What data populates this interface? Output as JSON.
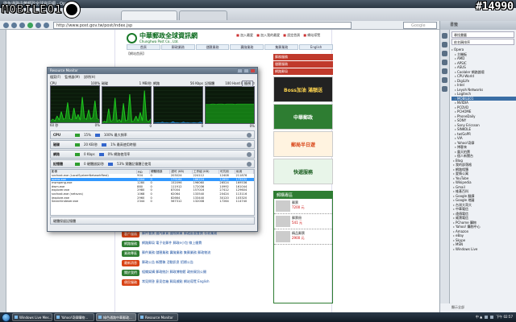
{
  "watermark": {
    "site": "MOBILE01",
    "post_id": "#14990"
  },
  "browser": {
    "title": "綠色通路中華郵政全球資訊網 - Opera",
    "address": "http://www.post.gov.tw/post/index.jsp",
    "search_placeholder": "Google"
  },
  "site": {
    "name_cn": "中華郵政全球資訊網",
    "name_en": "Chunghwa Post Co., Ltd.",
    "top_links": [
      "加入最愛",
      "加入我的最愛",
      "設定首頁",
      "網站導覽"
    ],
    "nav": [
      "首頁",
      "郵政業務",
      "儲匯業務",
      "壽險業務",
      "集郵業務",
      "English"
    ],
    "breadcrumb": "【網站首頁】",
    "side_labels": [
      "郵務服務",
      "儲匯服務",
      "網路郵局"
    ],
    "ads": [
      "Boss加油 滿額送",
      "中華郵政",
      "郵局半日遊",
      "快遞服務"
    ],
    "shop_title": "郵購專區",
    "shop_items": [
      {
        "name": "郵票",
        "price": "7200 元"
      },
      {
        "name": "郵票冊",
        "price": "541 元"
      },
      {
        "name": "精品郵票",
        "price": "2900 元"
      }
    ],
    "links": [
      {
        "tag": "客戶服務",
        "color": "#d84315",
        "text": "郵件查詢  國內郵資  國際郵資  郵遞區號查詢  存款業務"
      },
      {
        "tag": "網路服務",
        "color": "#2e7d32",
        "text": "網路郵局  電子化郵件  郵政e小包  線上繳費"
      },
      {
        "tag": "業務專區",
        "color": "#2e7d32",
        "text": "郵件業務  儲匯業務  壽險業務  集郵業務  郵政物流"
      },
      {
        "tag": "最新消息",
        "color": "#d84315",
        "text": "郵政公告  新聞稿  活動訊息  招標公告"
      },
      {
        "tag": "關於我們",
        "color": "#2e7d32",
        "text": "組織架構  郵政統計  郵政博物館  政府資訊公開"
      },
      {
        "tag": "便民服務",
        "color": "#d84315",
        "text": "常見問答  意見信箱  郵局據點  網站導覽  English"
      }
    ]
  },
  "resource_monitor": {
    "title": "Resource Monitor",
    "menu": [
      "檔案(F)",
      "監視器(M)",
      "說明(H)"
    ],
    "view_button": "檢視",
    "graphs": [
      {
        "label": "CPU",
        "max": "100%",
        "footer_left": "60 秒",
        "footer_right": "0%"
      },
      {
        "label": "磁碟",
        "max": "1 MB/秒",
        "footer_left": "",
        "footer_right": "0"
      },
      {
        "label": "網路",
        "max": "56 Kbps",
        "footer_left": "",
        "footer_right": "0"
      },
      {
        "label": "記憶體",
        "max": "100 Hard Faults/秒",
        "footer_left": "",
        "footer_right": "0%"
      }
    ],
    "sections": [
      {
        "name": "CPU",
        "a": "15%",
        "b": "100% 最大頻率"
      },
      {
        "name": "磁碟",
        "a": "20 KB/秒",
        "b": "1% 最高使用時間"
      },
      {
        "name": "網路",
        "a": "0 Kbps",
        "b": "0% 網路使用率"
      },
      {
        "name": "記憶體",
        "a": "0 硬體錯誤/秒",
        "b": "53% 實體記憶體已使用"
      }
    ],
    "table_headers": [
      "影像",
      "PID",
      "硬體錯誤",
      "認可 (KB)",
      "工作組 (KB)",
      "可共用",
      "私用"
    ],
    "table_rows": [
      [
        "svchost.exe (LocalSystemNetworkRest)",
        "904",
        "0",
        "203024",
        "224112",
        "12408",
        "211876"
      ],
      [
        "opera.exe",
        "5004",
        "0",
        "179164",
        "186224",
        "12692",
        "173532"
      ],
      [
        "msmpeng.exe",
        "1280",
        "0",
        "152096",
        "196060",
        "26524",
        "169536"
      ],
      [
        "dwm.exe",
        "880",
        "0",
        "111912",
        "172036",
        "10992",
        "161044"
      ],
      [
        "explorer.exe",
        "2980",
        "0",
        "87004",
        "157016",
        "27412",
        "129604"
      ],
      [
        "svchost.exe (netsvcs)",
        "1068",
        "0",
        "62064",
        "133540",
        "20424",
        "113116"
      ],
      [
        "iexplore.exe",
        "2960",
        "0",
        "82664",
        "133440",
        "30120",
        "103320"
      ],
      [
        "SearchIndexer.exe",
        "2344",
        "0",
        "567312",
        "132008",
        "17264",
        "114740"
      ]
    ],
    "footer": "硬體保留記憶體"
  },
  "panel": {
    "title": "書籤",
    "search_label": "尋找書籤",
    "sort_label": "依名稱排序",
    "items": [
      "Opera",
      "主機板",
      "AMD",
      "APSIC",
      "ASUS",
      "Coolaler 網路論壇",
      "CPU-World",
      "DigiLife",
      "Intel",
      "Leyoh Networks",
      "Logitech",
      "MOBILE01",
      "NVIDIA",
      "PCDVD",
      "PCHOME",
      "PhoneDaily",
      "SONY",
      "Sony Ericsson",
      "SINKOLE",
      "tw/GoPR",
      "VIA",
      "Yahoo!奇摩",
      "博客來",
      "露天拍賣",
      "個人新聞台",
      "Blog",
      "我的部落格",
      "網路相簿",
      "愛情公寓",
      "YouTube",
      "Wikipedia",
      "Gmail",
      "維基百科",
      "Google 翻譯",
      "Google 地圖",
      "台灣大哥大",
      "中華電信",
      "遠傳電信",
      "威寶電信",
      "PChome 購物",
      "Yahoo! 購物中心",
      "Amazon",
      "eBay",
      "Skype",
      "MSN",
      "Windows Live"
    ],
    "selected_index": 11,
    "bottom": "顯示全部"
  },
  "taskbar": {
    "items": [
      "Windows Live Mes...",
      "Yahoo!奇摩購物...",
      "綠色通路中華郵政...",
      "Resource Monitor"
    ],
    "active_index": 2,
    "tray_text": "中 ▲",
    "clock": "下午 02:57"
  },
  "graph_series": {
    "cpu": [
      5,
      9,
      4,
      18,
      6,
      30,
      8,
      12,
      55,
      10,
      7,
      40,
      9,
      22,
      6,
      70,
      12,
      8,
      35,
      9,
      14,
      60,
      10,
      8
    ],
    "disk": [
      2,
      6,
      3,
      40,
      5,
      8,
      70,
      4,
      10,
      3,
      55,
      6,
      9,
      80,
      4,
      7,
      20,
      5,
      30,
      6,
      90,
      8,
      4,
      12
    ],
    "network": [
      1,
      1,
      2,
      1,
      3,
      1,
      2,
      1,
      1,
      4,
      1,
      2,
      1,
      1,
      3,
      1,
      2,
      1,
      1,
      2,
      1,
      1,
      3,
      1
    ],
    "memory": [
      52,
      52,
      52,
      53,
      53,
      52,
      53,
      53,
      53,
      52,
      53,
      53,
      53,
      53,
      52,
      53,
      53,
      53,
      53,
      53,
      53,
      53,
      53,
      53
    ]
  },
  "colors": {
    "accent": "#3a6ea5",
    "site_green": "#2e7d32",
    "site_red": "#c0392b"
  }
}
